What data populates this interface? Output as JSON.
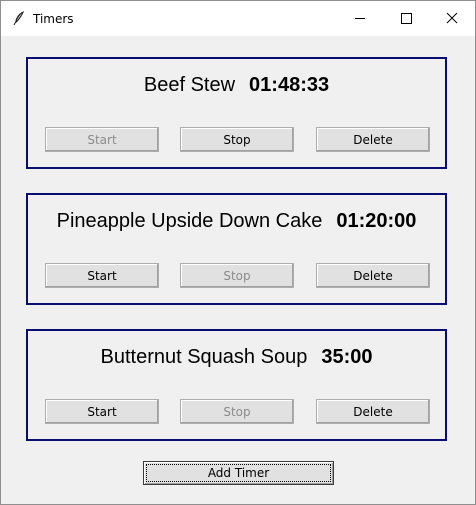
{
  "window": {
    "title": "Timers",
    "icon": "feather-icon",
    "controls": [
      "minimize-icon",
      "maximize-icon",
      "close-icon"
    ]
  },
  "timers": [
    {
      "name": "Beef Stew",
      "time": "01:48:33",
      "start_label": "Start",
      "stop_label": "Stop",
      "delete_label": "Delete",
      "start_enabled": false,
      "stop_enabled": true
    },
    {
      "name": "Pineapple Upside Down Cake",
      "time": "01:20:00",
      "start_label": "Start",
      "stop_label": "Stop",
      "delete_label": "Delete",
      "start_enabled": true,
      "stop_enabled": false
    },
    {
      "name": "Butternut Squash Soup",
      "time": "35:00",
      "start_label": "Start",
      "stop_label": "Stop",
      "delete_label": "Delete",
      "start_enabled": true,
      "stop_enabled": false
    }
  ],
  "add_timer_label": "Add Timer",
  "colors": {
    "timer_border": "#0b0b74",
    "background": "#f0f0f0",
    "disabled_text": "#8b8b8b"
  }
}
